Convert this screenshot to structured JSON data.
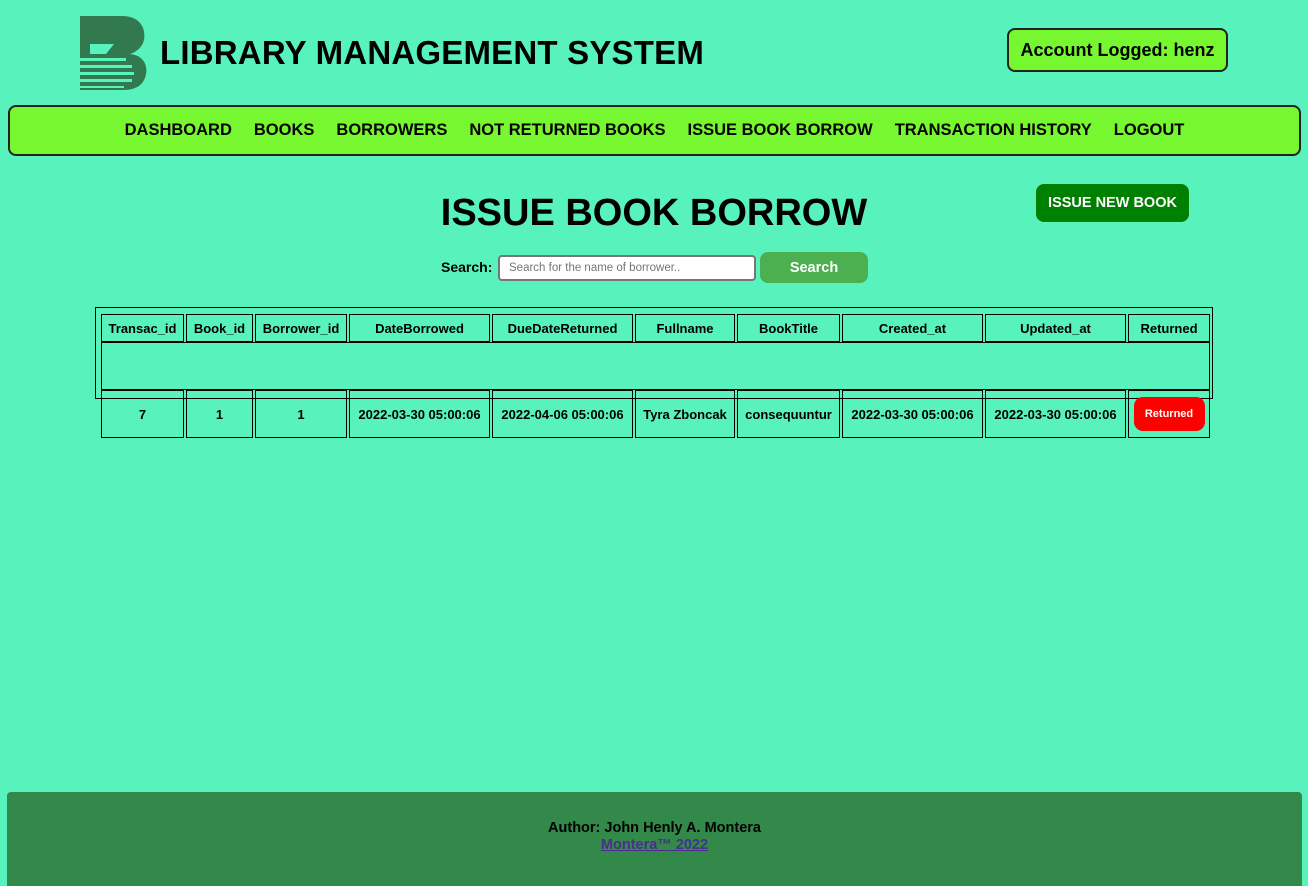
{
  "header": {
    "title": "LIBRARY MANAGEMENT SYSTEM",
    "account_label": "Account Logged: henz",
    "logo_icon": "library-book-logo-icon"
  },
  "nav": {
    "items": [
      {
        "label": "DASHBOARD"
      },
      {
        "label": "BOOKS"
      },
      {
        "label": "BORROWERS"
      },
      {
        "label": "NOT RETURNED BOOKS"
      },
      {
        "label": "ISSUE BOOK BORROW"
      },
      {
        "label": "TRANSACTION HISTORY"
      },
      {
        "label": "LOGOUT"
      }
    ]
  },
  "main": {
    "title": "ISSUE BOOK BORROW",
    "issue_button_label": "ISSUE NEW BOOK",
    "search": {
      "label": "Search:",
      "placeholder": "Search for the name of borrower..",
      "value": "",
      "button_label": "Search"
    }
  },
  "table": {
    "columns": [
      "Transac_id",
      "Book_id",
      "Borrower_id",
      "DateBorrowed",
      "DueDateReturned",
      "Fullname",
      "BookTitle",
      "Created_at",
      "Updated_at",
      "Returned"
    ],
    "rows": [
      {
        "transac_id": "7",
        "book_id": "1",
        "borrower_id": "1",
        "date_borrowed": "2022-03-30 05:00:06",
        "due_date_returned": "2022-04-06 05:00:06",
        "fullname": "Tyra Zboncak",
        "book_title": "consequuntur",
        "created_at": "2022-03-30 05:00:06",
        "updated_at": "2022-03-30 05:00:06",
        "returned_label": "Returned"
      }
    ]
  },
  "footer": {
    "author": "Author: John Henly A. Montera",
    "link": "Montera™ 2022"
  },
  "colors": {
    "page_background": "#58f2bc",
    "nav_background": "#76f72f",
    "issue_button": "#008000",
    "search_button": "#4caf50",
    "returned_button": "#ff0000",
    "footer_background": "#32894a",
    "logo": "#32794f"
  }
}
